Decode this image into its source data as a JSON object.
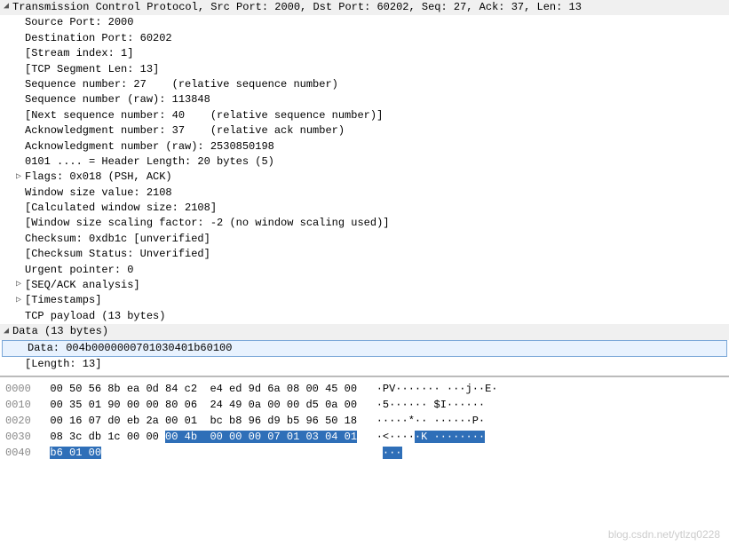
{
  "tcp": {
    "summary": "Transmission Control Protocol, Src Port: 2000, Dst Port: 60202, Seq: 27, Ack: 37, Len: 13",
    "src_port": "Source Port: 2000",
    "dst_port": "Destination Port: 60202",
    "stream_index": "[Stream index: 1]",
    "segment_len": "[TCP Segment Len: 13]",
    "seq": "Sequence number: 27    (relative sequence number)",
    "seq_raw": "Sequence number (raw): 113848",
    "next_seq": "[Next sequence number: 40    (relative sequence number)]",
    "ack": "Acknowledgment number: 37    (relative ack number)",
    "ack_raw": "Acknowledgment number (raw): 2530850198",
    "hdr_len": "0101 .... = Header Length: 20 bytes (5)",
    "flags": "Flags: 0x018 (PSH, ACK)",
    "win": "Window size value: 2108",
    "calc_win": "[Calculated window size: 2108]",
    "win_scale": "[Window size scaling factor: -2 (no window scaling used)]",
    "checksum": "Checksum: 0xdb1c [unverified]",
    "checksum_status": "[Checksum Status: Unverified]",
    "urgent": "Urgent pointer: 0",
    "seq_ack": "[SEQ/ACK analysis]",
    "timestamps": "[Timestamps]",
    "payload": "TCP payload (13 bytes)"
  },
  "data_section": {
    "header": "Data (13 bytes)",
    "data": "Data: 004b0000000701030401b60100",
    "length": "[Length: 13]"
  },
  "hex": {
    "rows": [
      {
        "offset": "0000",
        "hex_a": "00 50 56 8b ea 0d 84 c2  e4 ed 9d 6a 08 00 45 00",
        "ascii": "·PV······· ···j··E·"
      },
      {
        "offset": "0010",
        "hex_a": "00 35 01 90 00 00 80 06  24 49 0a 00 00 d5 0a 00",
        "ascii": "·5······ $I······"
      },
      {
        "offset": "0020",
        "hex_a": "00 16 07 d0 eb 2a 00 01  bc b8 96 d9 b5 96 50 18",
        "ascii": "·····*·· ······P·"
      }
    ],
    "row30": {
      "offset": "0030",
      "hex_plain": "08 3c db 1c 00 00 ",
      "hex_hl": "00 4b  00 00 00 07 01 03 04 01",
      "ascii_plain": "·<····",
      "ascii_hl": "·K ········"
    },
    "row40": {
      "offset": "0040",
      "hex_hl": "b6 01 00",
      "ascii_hl": "···"
    }
  },
  "watermark": "blog.csdn.net/ytlzq0228"
}
